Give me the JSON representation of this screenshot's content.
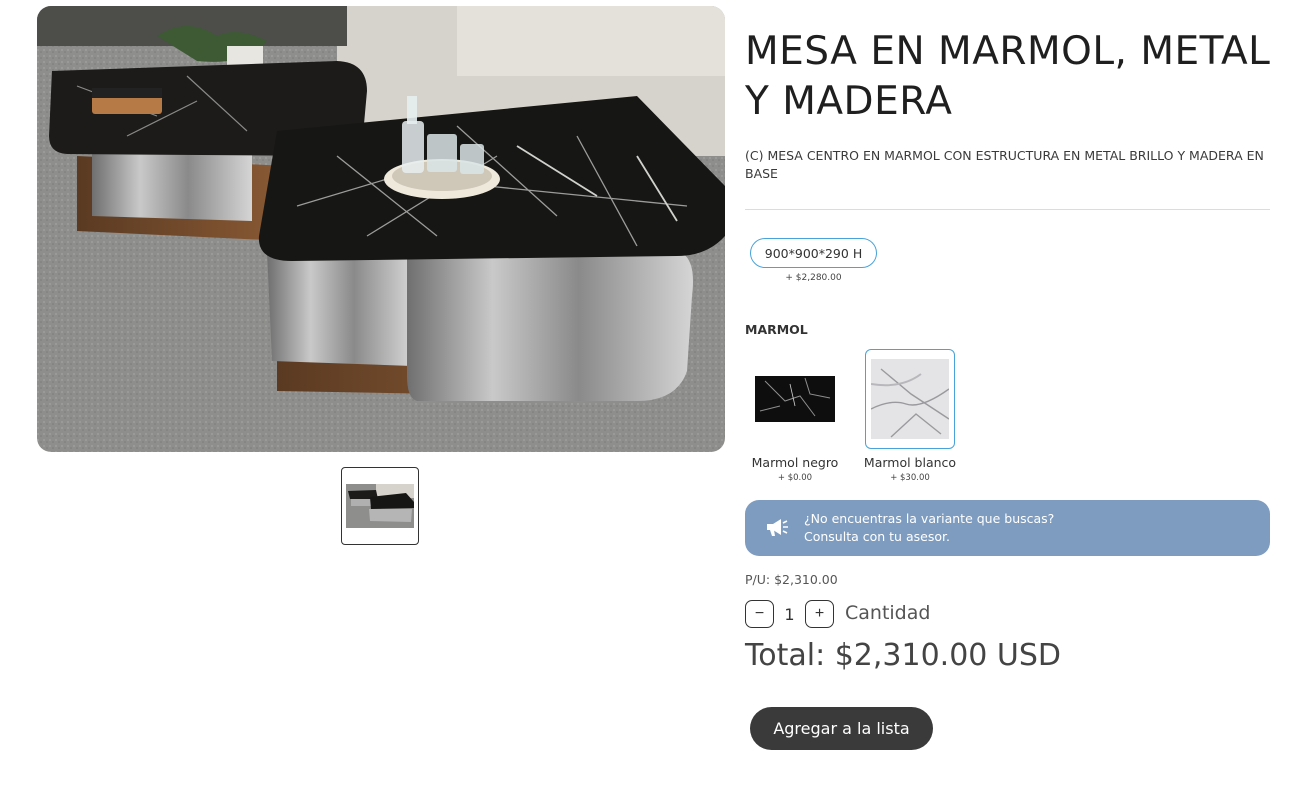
{
  "product": {
    "title": "MESA EN MARMOL, METAL Y MADERA",
    "subtitle": "(C) MESA CENTRO EN MARMOL CON ESTRUCTURA EN METAL BRILLO Y MADERA EN BASE",
    "image_alt": "Mesa de centro en marmol negro"
  },
  "size_option": {
    "label": "900*900*290 H",
    "price": "+ $2,280.00"
  },
  "marble": {
    "section_label": "MARMOL",
    "options": [
      {
        "label": "Marmol negro",
        "price": "+ $0.00",
        "color": "#111111",
        "selected": false
      },
      {
        "label": "Marmol blanco",
        "price": "+ $30.00",
        "color": "#d9d9db",
        "selected": true
      }
    ]
  },
  "banner": {
    "line1": "¿No encuentras la variante que buscas?",
    "line2": "Consulta con tu asesor.",
    "icon": "megaphone-icon",
    "color": "#7e9cc0"
  },
  "pricing": {
    "unit_price": "P/U: $2,310.00",
    "quantity": "1",
    "quantity_label": "Cantidad",
    "minus_label": "−",
    "plus_label": "+",
    "total": "Total: $2,310.00 USD"
  },
  "actions": {
    "add_to_list": "Agregar a la lista"
  },
  "colors": {
    "accent": "#4aa3d8",
    "button": "#3a3a3a"
  }
}
